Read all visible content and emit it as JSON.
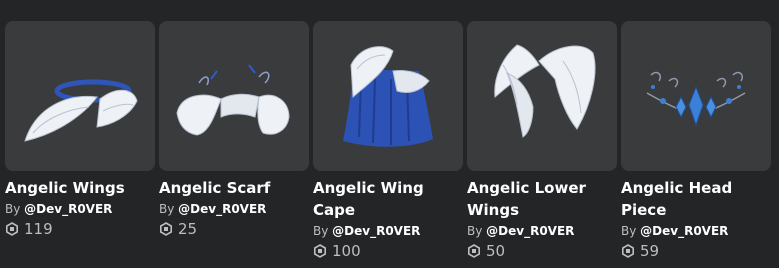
{
  "items": [
    {
      "name": "Angelic Wings",
      "by_prefix": "By",
      "creator": "@Dev_R0VER",
      "price": "119",
      "icon": "angelic-wings-thumbnail"
    },
    {
      "name": "Angelic Scarf",
      "by_prefix": "By",
      "creator": "@Dev_R0VER",
      "price": "25",
      "icon": "angelic-scarf-thumbnail"
    },
    {
      "name": "Angelic Wing Cape",
      "by_prefix": "By",
      "creator": "@Dev_R0VER",
      "price": "100",
      "icon": "angelic-wing-cape-thumbnail"
    },
    {
      "name": "Angelic Lower Wings",
      "by_prefix": "By",
      "creator": "@Dev_R0VER",
      "price": "50",
      "icon": "angelic-lower-wings-thumbnail"
    },
    {
      "name": "Angelic Head Piece",
      "by_prefix": "By",
      "creator": "@Dev_R0VER",
      "price": "59",
      "icon": "angelic-head-piece-thumbnail"
    }
  ],
  "currency_icon": "robux-icon",
  "colors": {
    "background": "#232527",
    "card": "#393b3d",
    "text": "#ffffff",
    "muted": "#bdbebe",
    "wing_white": "#eef1f6",
    "accent_blue": "#2f5bc4"
  }
}
